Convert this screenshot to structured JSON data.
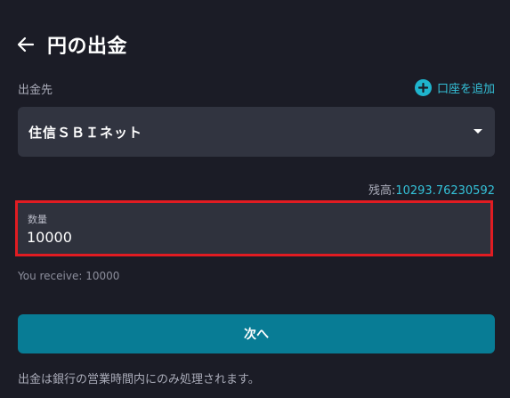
{
  "header": {
    "title": "円の出金",
    "back_icon": "arrow-left-icon"
  },
  "destination": {
    "label": "出金先",
    "add_account_label": "口座を追加",
    "add_icon": "plus-circle-icon",
    "selected_bank": "住信ＳＢＩネット",
    "dropdown_icon": "caret-down-icon"
  },
  "balance": {
    "label": "残高:",
    "value": "10293.76230592"
  },
  "amount": {
    "label": "数量",
    "value": "10000"
  },
  "receive": {
    "text": "You receive: 10000"
  },
  "actions": {
    "next_label": "次へ"
  },
  "notice": {
    "text": "出金は銀行の営業時間内にのみ処理されます。"
  },
  "colors": {
    "background": "#1b1c26",
    "accent": "#34c1d8",
    "button": "#087c95",
    "highlight_border": "#e11c22",
    "field_background": "#313440"
  }
}
